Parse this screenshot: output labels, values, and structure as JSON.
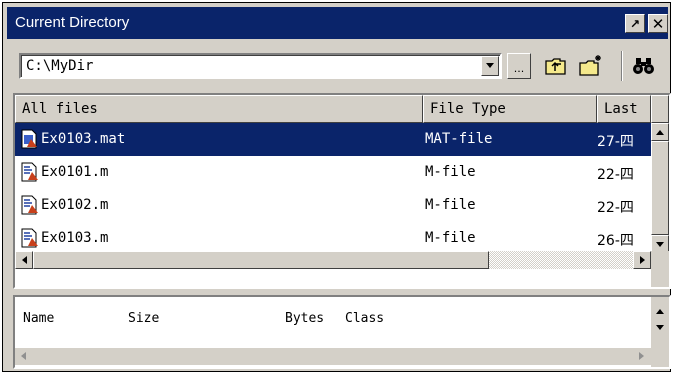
{
  "window": {
    "title": "Current Directory",
    "undock_label": "↗",
    "close_label": "✕"
  },
  "toolbar": {
    "path": "C:\\MyDir",
    "browse_label": "..."
  },
  "file_list": {
    "columns": [
      "All files",
      "File Type",
      "Last"
    ],
    "rows": [
      {
        "name": "Ex0103.mat",
        "type": "MAT-file",
        "date": "27-四",
        "icon": "mat-file-icon",
        "selected": true
      },
      {
        "name": "Ex0101.m",
        "type": "M-file",
        "date": "22-四",
        "icon": "m-file-icon",
        "selected": false
      },
      {
        "name": "Ex0102.m",
        "type": "M-file",
        "date": "22-四",
        "icon": "m-file-icon",
        "selected": false
      },
      {
        "name": "Ex0103.m",
        "type": "M-file",
        "date": "26-四",
        "icon": "m-file-icon",
        "selected": false
      }
    ]
  },
  "workspace": {
    "columns": [
      "Name",
      "Size",
      "Bytes",
      "Class"
    ]
  },
  "colors": {
    "selection": "#0a246a",
    "face": "#d4d0c8"
  }
}
